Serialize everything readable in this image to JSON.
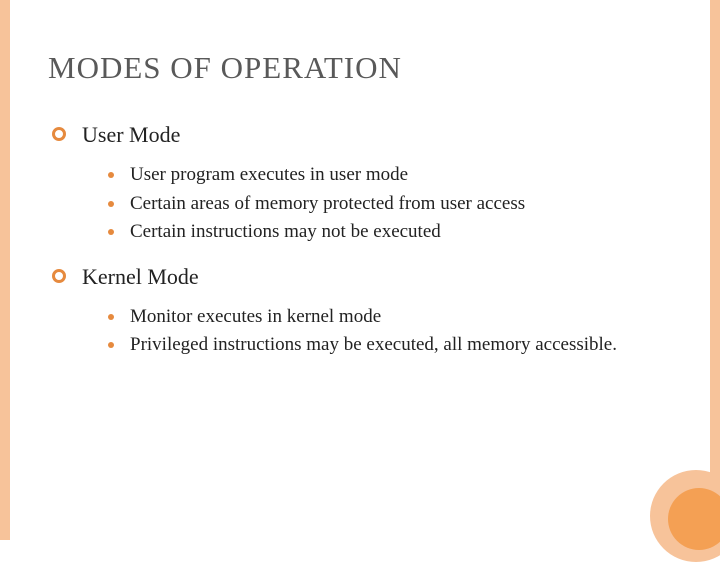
{
  "title": "MODES OF OPERATION",
  "sections": [
    {
      "label": "User Mode",
      "items": [
        "User program executes in user mode",
        "Certain areas of memory protected from user access",
        "Certain instructions may not be executed"
      ]
    },
    {
      "label": "Kernel Mode",
      "items": [
        "Monitor executes in kernel mode",
        "Privileged instructions may be executed, all memory accessible."
      ]
    }
  ]
}
